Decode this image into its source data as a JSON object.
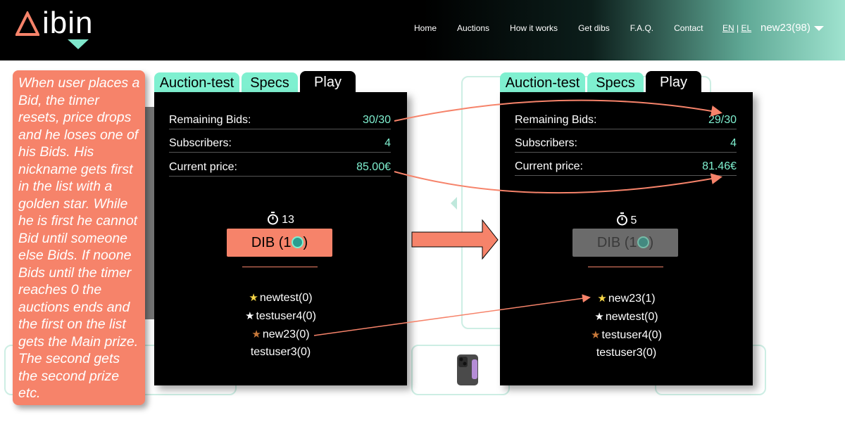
{
  "header": {
    "logo_text": "ibin",
    "nav": [
      "Home",
      "Auctions",
      "How it works",
      "Get dibs",
      "F.A.Q.",
      "Contact"
    ],
    "lang": {
      "en": "EN",
      "sep": " | ",
      "el": "EL"
    },
    "user": "new23(98)"
  },
  "note": {
    "text": "When user places a Bid, the timer resets, price drops and he loses one of his Bids. His nickname gets first in the list with a golden star. While he is first he cannot Bid until someone else Bids. If noone Bids until the timer reaches 0 the auctions ends and the first on the list gets the Main prize. The second gets the second prize etc."
  },
  "colors": {
    "accent": "#7ff0d0",
    "coral": "#f6836a",
    "gold": "#f5d547",
    "silver": "#ffffff",
    "bronze": "#c8793a"
  },
  "before": {
    "tabs": [
      "Auction-test",
      "Specs",
      "Play"
    ],
    "remaining_label": "Remaining Bids:",
    "remaining_value": "30/30",
    "subs_label": "Subscribers:",
    "subs_value": "4",
    "price_label": "Current price:",
    "price_value": "85.00€",
    "timer": "13",
    "dib_left": "DIB (1",
    "dib_right": ")",
    "bidders": [
      {
        "star": "gold",
        "name": "newtest(0)"
      },
      {
        "star": "silver",
        "name": "testuser4(0)"
      },
      {
        "star": "bronze",
        "name": "new23(0)"
      },
      {
        "star": "none",
        "name": "testuser3(0)"
      }
    ]
  },
  "after": {
    "tabs": [
      "Auction-test",
      "Specs",
      "Play"
    ],
    "remaining_label": "Remaining Bids:",
    "remaining_value": "29/30",
    "subs_label": "Subscribers:",
    "subs_value": "4",
    "price_label": "Current price:",
    "price_value": "81.46€",
    "timer": "5",
    "dib_left": "DIB (1",
    "dib_right": ")",
    "bidders": [
      {
        "star": "gold",
        "name": "new23(1)"
      },
      {
        "star": "silver",
        "name": "newtest(0)"
      },
      {
        "star": "bronze",
        "name": "testuser4(0)"
      },
      {
        "star": "none",
        "name": "testuser3(0)"
      }
    ]
  }
}
